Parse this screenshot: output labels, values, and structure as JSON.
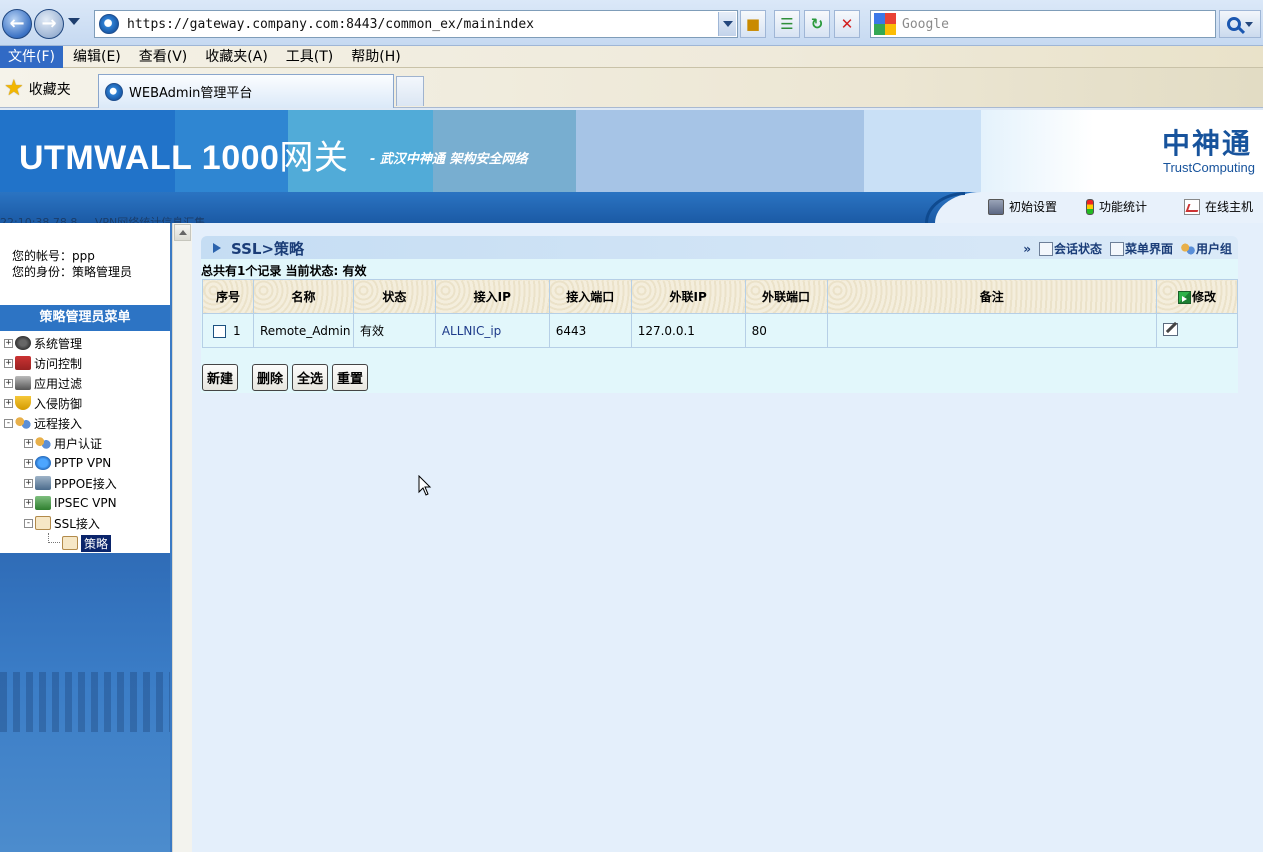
{
  "browser": {
    "address_url": "https://gateway.company.com:8443/common_ex/mainindex",
    "search_placeholder": "Google",
    "menu": [
      "文件(F)",
      "编辑(E)",
      "查看(V)",
      "收藏夹(A)",
      "工具(T)",
      "帮助(H)"
    ],
    "favorites_label": "收藏夹",
    "tab_title": "WEBAdmin管理平台"
  },
  "header": {
    "title_main": "UTMWALL 1000",
    "title_suffix": "网关",
    "slogan": "- 武汉中神通  架构安全网络",
    "brand_cn": "中神通",
    "brand_en": "TrustComputing",
    "actions": {
      "init_setup": "初始设置",
      "func_stats": "功能统计",
      "online_hosts": "在线主机"
    },
    "marquee": "22:10:38  78.8  ...  VPN网络统计信息汇集"
  },
  "sidebar": {
    "account": "您的帐号：ppp",
    "role": "您的身份：策略管理员",
    "menu_title": "策略管理员菜单",
    "tree": {
      "system_mgmt": "系统管理",
      "access_control": "访问控制",
      "app_filter": "应用过滤",
      "intrusion": "入侵防御",
      "remote_access": "远程接入",
      "user_auth": "用户认证",
      "pptp": "PPTP VPN",
      "pppoe": "PPPOE接入",
      "ipsec": "IPSEC VPN",
      "ssl": "SSL接入",
      "policy": "策略"
    }
  },
  "panel": {
    "title": "SSL>策略",
    "links_prefix": "»",
    "links": {
      "session_status": "会话状态",
      "menu_view": "菜单界面",
      "user_group": "用户组"
    },
    "summary": "总共有1个记录  当前状态: 有效",
    "columns": {
      "index": "序号",
      "name": "名称",
      "status": "状态",
      "access_ip": "接入IP",
      "access_port": "接入端口",
      "ext_ip": "外联IP",
      "ext_port": "外联端口",
      "remark": "备注",
      "edit": "修改"
    },
    "rows": [
      {
        "index": "1",
        "name": "Remote_Admin",
        "status": "有效",
        "access_ip": "ALLNIC_ip",
        "access_port": "6443",
        "ext_ip": "127.0.0.1",
        "ext_port": "80",
        "remark": ""
      }
    ],
    "buttons": {
      "new": "新建",
      "delete": "删除",
      "select_all": "全选",
      "reset": "重置"
    }
  }
}
